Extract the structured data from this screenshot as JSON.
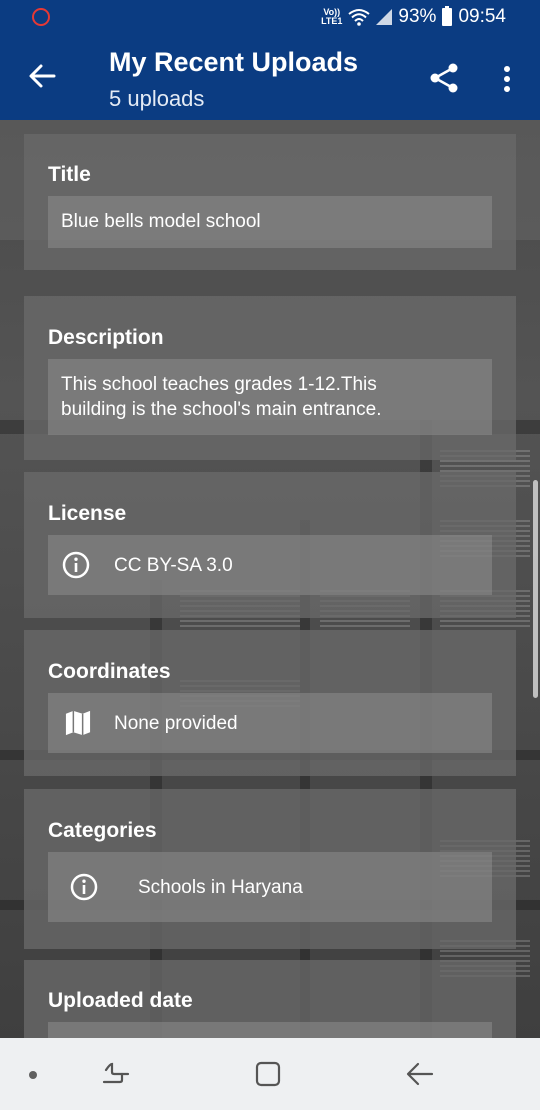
{
  "status": {
    "volte": "Vo)) LTE1",
    "battery": "93%",
    "time": "09:54"
  },
  "appbar": {
    "title": "My Recent Uploads",
    "subtitle": "5 uploads"
  },
  "cards": {
    "title": {
      "heading": "Title",
      "value": "Blue bells model school"
    },
    "description": {
      "heading": "Description",
      "value_line1": "This school teaches grades 1-12.This",
      "value_line2": "building is the school's main entrance."
    },
    "license": {
      "heading": "License",
      "value": "CC BY-SA 3.0",
      "icon": "info-icon"
    },
    "coordinates": {
      "heading": "Coordinates",
      "value": "None provided",
      "icon": "map-icon"
    },
    "categories": {
      "heading": "Categories",
      "value": "Schools in Haryana",
      "icon": "info-icon"
    },
    "uploaded_date": {
      "heading": "Uploaded date"
    }
  },
  "colors": {
    "primary": "#0b3c82",
    "card": "#696969",
    "navbar": "#eef0f2"
  }
}
